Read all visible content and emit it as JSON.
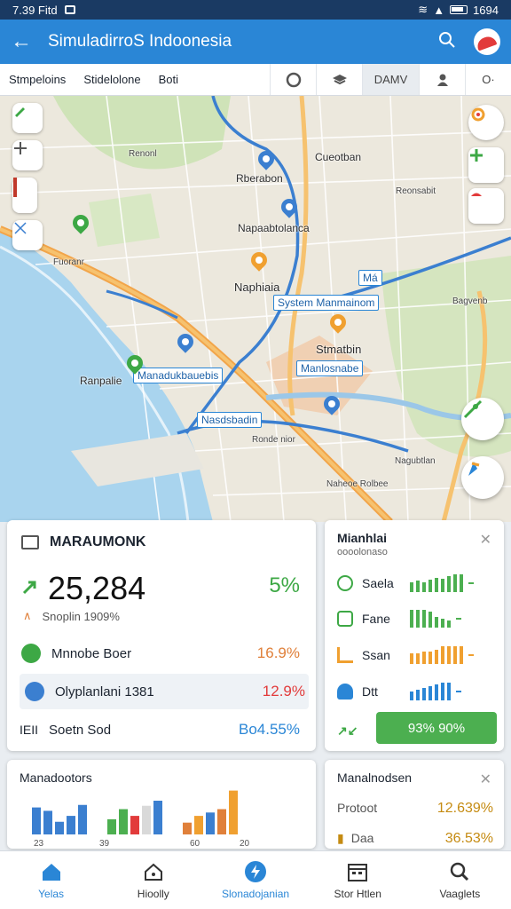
{
  "status_bar": {
    "time": "7.39 Fitd",
    "right_text": "1694"
  },
  "app_bar": {
    "title": "SimuladirroS Indoonesia"
  },
  "toolbar": {
    "tab_1": "Stmpeloins",
    "tab_2": "Stidelolone",
    "tab_3": "Boti",
    "active_btn": "DAMV",
    "more_btn": "O·"
  },
  "map": {
    "labels": [
      "Cueotban",
      "Rberabon",
      "Napaabtolanca",
      "Naphiaia",
      "Stmatbin",
      "Ranpalie",
      "Renonl",
      "Reonsabit",
      "Ronde nior",
      "Fuoranr",
      "Bagvenb",
      "Nagubtlan",
      "Naheoe Rolbee"
    ],
    "tags": [
      "System Manmainom",
      "Má",
      "Manadukbauebis",
      "Manlosnabe",
      "Nasdsbadin"
    ]
  },
  "card_main": {
    "title": "MARAUMONK",
    "value": "25,284",
    "percent": "5%",
    "subtext": "Snoplin 1909%",
    "rows": [
      {
        "label": "Mnnobe Boer",
        "value": "16.9%",
        "color": "#e0803a"
      },
      {
        "label": "Olyplanlani 1381",
        "value": "12.9%",
        "color": "#e23b3b"
      },
      {
        "label": "Soetn Sod",
        "value": "Bo4.55%",
        "color": "#2a86d6",
        "prefix": "IEII"
      }
    ]
  },
  "card_side": {
    "title": "Mianhlai",
    "subtitle": "oooolonaso",
    "rows": [
      {
        "label": "Saela",
        "bars": [
          0.55,
          0.65,
          0.55,
          0.7,
          0.8,
          0.75,
          0.9,
          1.0,
          1.0
        ],
        "color": "#4caf50"
      },
      {
        "label": "Fane",
        "bars": [
          1.0,
          1.0,
          1.0,
          0.9,
          0.6,
          0.5,
          0.4
        ],
        "color": "#4caf50"
      },
      {
        "label": "Ssan",
        "bars": [
          0.6,
          0.6,
          0.7,
          0.7,
          0.8,
          1.0,
          1.0,
          1.0,
          1.0
        ],
        "color": "#f0a030"
      },
      {
        "label": "Dtt",
        "bars": [
          0.5,
          0.6,
          0.7,
          0.8,
          0.9,
          1.0,
          1.0
        ],
        "color": "#2a86d6"
      }
    ],
    "button": "93% 90%",
    "footer_icon": "↗↙"
  },
  "card_chart": {
    "title": "Manadootors",
    "chart_data": {
      "type": "bar",
      "xlabel": "",
      "ylabel": "",
      "tick_labels": [
        "23",
        "39",
        "60",
        "20"
      ],
      "series": [
        {
          "values": [
            32,
            28,
            15,
            22,
            35
          ]
        },
        {
          "values": [
            18,
            30,
            22,
            34,
            40
          ]
        },
        {
          "values": [
            14,
            22,
            26,
            30,
            52
          ]
        }
      ]
    }
  },
  "card_mini": {
    "title": "Manalnodsen",
    "rows": [
      {
        "label": "Protoot",
        "value": "12.639%",
        "color": "#c58b12"
      },
      {
        "label": "Daa",
        "value": "36.53%",
        "color": "#c58b12"
      }
    ]
  },
  "bottom_nav": [
    {
      "label": "Yelas",
      "icon": "home-icon"
    },
    {
      "label": "Hioolly",
      "icon": "house-outline-icon"
    },
    {
      "label": "Slonadojanian",
      "icon": "bolt-icon"
    },
    {
      "label": "Stor Htlen",
      "icon": "calendar-icon"
    },
    {
      "label": "Vaaglets",
      "icon": "search-icon"
    }
  ],
  "colors": {
    "primary": "#2a86d6",
    "green": "#4caf50",
    "orange": "#e0803a",
    "red": "#e23b3b"
  }
}
